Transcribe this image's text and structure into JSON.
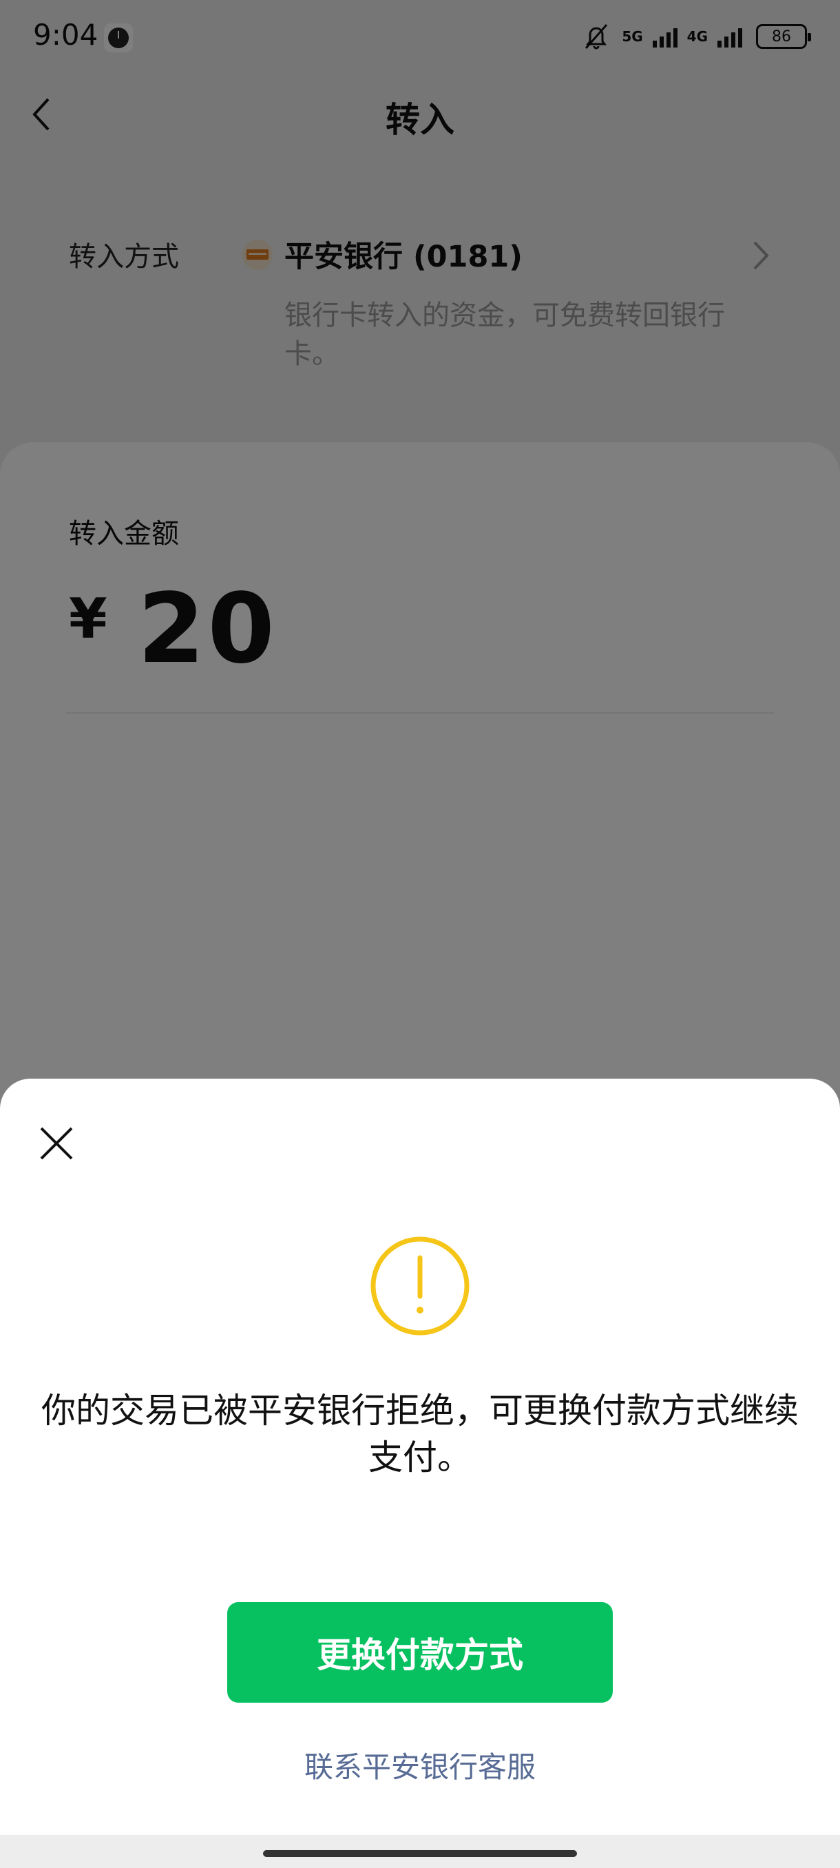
{
  "status_bar": {
    "time": "9:04",
    "net1": "5G",
    "net2": "4G",
    "battery": "86"
  },
  "nav": {
    "title": "转入"
  },
  "method": {
    "label": "转入方式",
    "bank_name": "平安银行 (0181)",
    "note": "银行卡转入的资金，可免费转回银行卡。"
  },
  "amount": {
    "label": "转入金额",
    "currency": "¥",
    "value": "20"
  },
  "dialog": {
    "message": "你的交易已被平安银行拒绝，可更换付款方式继续支付。",
    "primary_button": "更换付款方式",
    "support_link": "联系平安银行客服"
  },
  "colors": {
    "accent_green": "#07c160",
    "warning_yellow": "#f5c518",
    "link_blue": "#576b95"
  },
  "icons": [
    "clock-app-icon",
    "mute-icon",
    "signal-icon",
    "battery-icon",
    "back-icon",
    "bank-logo",
    "chevron-right-icon",
    "close-icon",
    "warning-icon"
  ]
}
